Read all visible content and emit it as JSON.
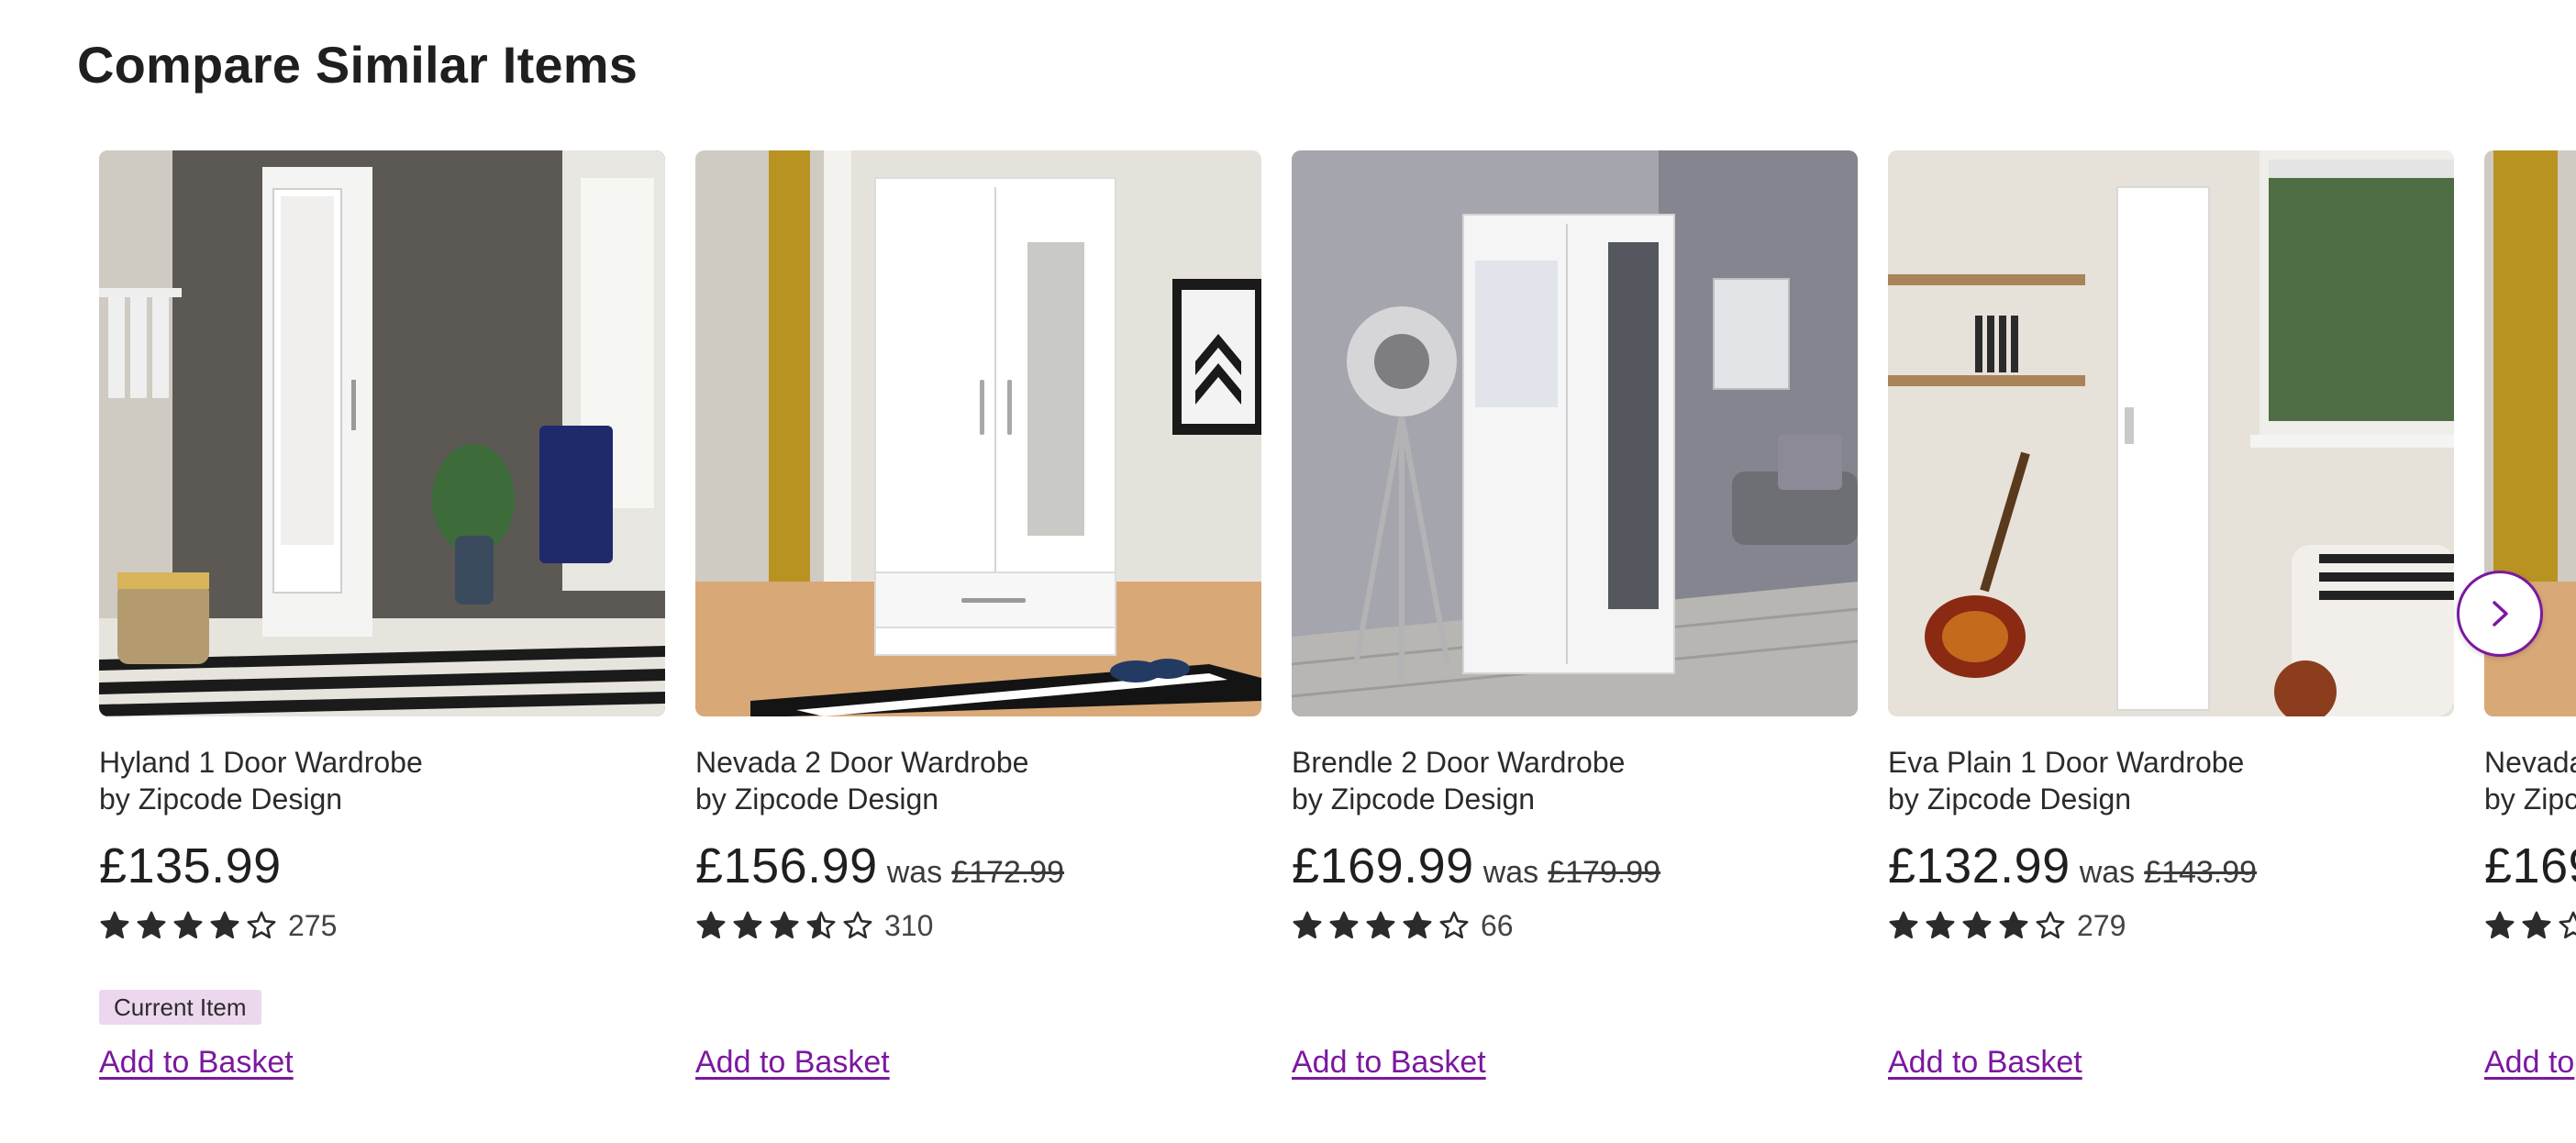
{
  "section": {
    "title": "Compare Similar Items"
  },
  "colors": {
    "accent": "#7b189f",
    "badge_bg": "#ecd7ee",
    "star": "#2b2b2b"
  },
  "products": [
    {
      "name": "Hyland 1 Door Wardrobe",
      "brand": "by Zipcode Design",
      "price": "£135.99",
      "was_label": "",
      "was_price": "",
      "rating": 4,
      "review_count": "275",
      "badge": "Current Item",
      "add_label": "Add to Basket"
    },
    {
      "name": "Nevada 2 Door Wardrobe",
      "brand": "by Zipcode Design",
      "price": "£156.99",
      "was_label": "was",
      "was_price": "£172.99",
      "rating": 3.5,
      "review_count": "310",
      "badge": "",
      "add_label": "Add to Basket"
    },
    {
      "name": "Brendle 2 Door Wardrobe",
      "brand": "by Zipcode Design",
      "price": "£169.99",
      "was_label": "was",
      "was_price": "£179.99",
      "rating": 4,
      "review_count": "66",
      "badge": "",
      "add_label": "Add to Basket"
    },
    {
      "name": "Eva Plain 1 Door Wardrobe",
      "brand": "by Zipcode Design",
      "price": "£132.99",
      "was_label": "was",
      "was_price": "£143.99",
      "rating": 4,
      "review_count": "279",
      "badge": "",
      "add_label": "Add to Basket"
    },
    {
      "name": "Nevada",
      "brand": "by Zipc",
      "price": "£169",
      "was_label": "",
      "was_price": "",
      "rating": 2,
      "review_count": "",
      "badge": "",
      "add_label": "Add to"
    }
  ],
  "carousel": {
    "next_icon": "chevron-right-icon"
  }
}
